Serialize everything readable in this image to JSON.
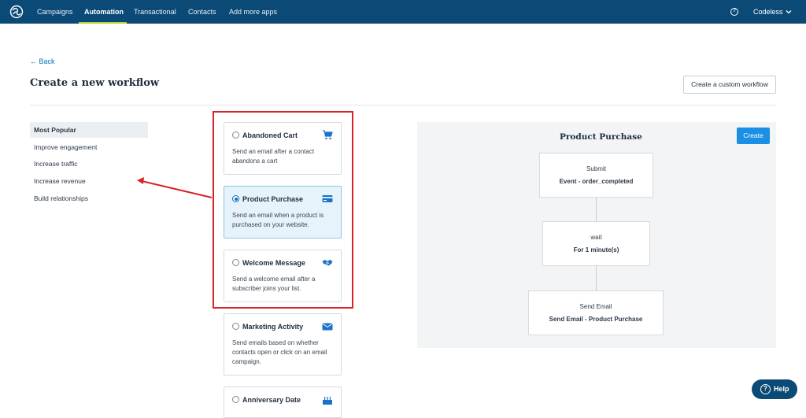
{
  "nav": {
    "items": [
      "Campaigns",
      "Automation",
      "Transactional",
      "Contacts",
      "Add more apps"
    ],
    "active": "Automation",
    "help_glyph": "?",
    "user": "Codeless"
  },
  "header": {
    "back": "← Back",
    "title": "Create a new workflow",
    "custom_button": "Create a custom workflow"
  },
  "sidebar": {
    "items": [
      "Most Popular",
      "Improve engagement",
      "Increase traffic",
      "Increase revenue",
      "Build relationships"
    ]
  },
  "cards": [
    {
      "title": "Abandoned Cart",
      "desc": "Send an email after a contact abandons a cart",
      "icon": "cart-icon",
      "selected": false
    },
    {
      "title": "Product Purchase",
      "desc": "Send an email when a product is purchased on your website.",
      "icon": "credit-card-icon",
      "selected": true
    },
    {
      "title": "Welcome Message",
      "desc": "Send a welcome email after a subscriber joins your list.",
      "icon": "handshake-icon",
      "selected": false
    },
    {
      "title": "Marketing Activity",
      "desc": "Send emails based on whether contacts open or click on an email campaign.",
      "icon": "envelope-icon",
      "selected": false
    },
    {
      "title": "Anniversary Date",
      "desc": "",
      "icon": "cake-icon",
      "selected": false
    }
  ],
  "preview": {
    "title": "Product Purchase",
    "create": "Create",
    "steps": [
      {
        "l1": "Submit",
        "l2": "Event - order_completed"
      },
      {
        "l1": "wait",
        "l2": "For 1 minute(s)"
      },
      {
        "l1": "Send Email",
        "l2": "Send Email - Product Purchase"
      }
    ]
  },
  "help": {
    "label": "Help",
    "glyph": "?"
  },
  "colors": {
    "nav_bg": "#0b4a76",
    "accent": "#1a8fe3",
    "highlight": "#d8232a",
    "nav_underline": "#b5d334"
  }
}
